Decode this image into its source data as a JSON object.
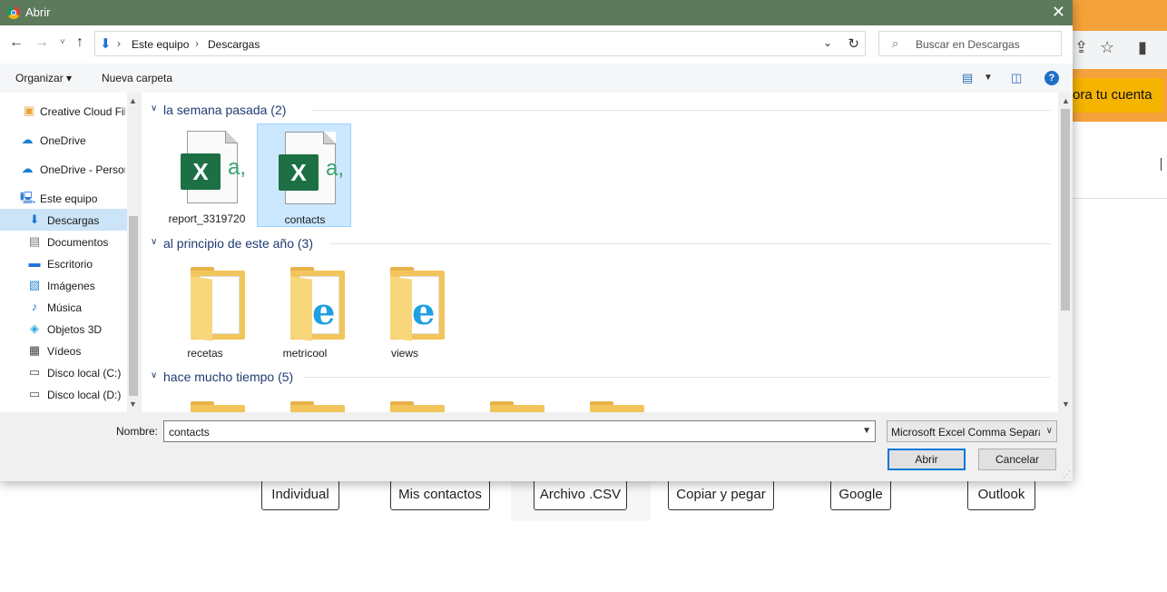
{
  "background_page": {
    "cta_label": "ora tu cuenta",
    "source_buttons": [
      "Individual",
      "Mis contactos",
      "Archivo .CSV",
      "Copiar y pegar",
      "Google",
      "Outlook"
    ]
  },
  "dialog": {
    "title": "Abrir",
    "close_glyph": "✕",
    "address": {
      "crumbs": [
        "Este equipo",
        "Descargas"
      ]
    },
    "search_placeholder": "Buscar en Descargas",
    "commands": {
      "organize": "Organizar ▾",
      "new_folder": "Nueva carpeta",
      "help": "?"
    },
    "nav_items": [
      {
        "label": "Creative Cloud Fil",
        "icon": "creative-cloud-icon"
      },
      {
        "label": "OneDrive",
        "icon": "onedrive-icon"
      },
      {
        "label": "OneDrive - Person",
        "icon": "onedrive-icon"
      },
      {
        "label": "Este equipo",
        "icon": "computer-icon"
      },
      {
        "label": "Descargas",
        "icon": "download-icon",
        "selected": true
      },
      {
        "label": "Documentos",
        "icon": "document-icon"
      },
      {
        "label": "Escritorio",
        "icon": "desktop-icon"
      },
      {
        "label": "Imágenes",
        "icon": "pictures-icon"
      },
      {
        "label": "Música",
        "icon": "music-icon"
      },
      {
        "label": "Objetos 3D",
        "icon": "3d-objects-icon"
      },
      {
        "label": "Vídeos",
        "icon": "video-icon"
      },
      {
        "label": "Disco local (C:)",
        "icon": "drive-icon"
      },
      {
        "label": "Disco local (D:)",
        "icon": "drive-icon"
      }
    ],
    "groups": [
      {
        "label": "la semana pasada (2)",
        "files": [
          {
            "name": "report_3319720",
            "type": "excel-csv"
          },
          {
            "name": "contacts",
            "type": "excel-csv",
            "selected": true
          }
        ]
      },
      {
        "label": "al principio de este año (3)",
        "files": [
          {
            "name": "recetas",
            "type": "folder"
          },
          {
            "name": "metricool",
            "type": "folder-ie"
          },
          {
            "name": "views",
            "type": "folder-ie"
          }
        ]
      },
      {
        "label": "hace mucho tiempo (5)",
        "files": []
      }
    ],
    "filename_label": "Nombre:",
    "filename_value": "contacts",
    "filetype_value": "Microsoft Excel Comma Separa",
    "open_button": "Abrir",
    "cancel_button": "Cancelar"
  }
}
